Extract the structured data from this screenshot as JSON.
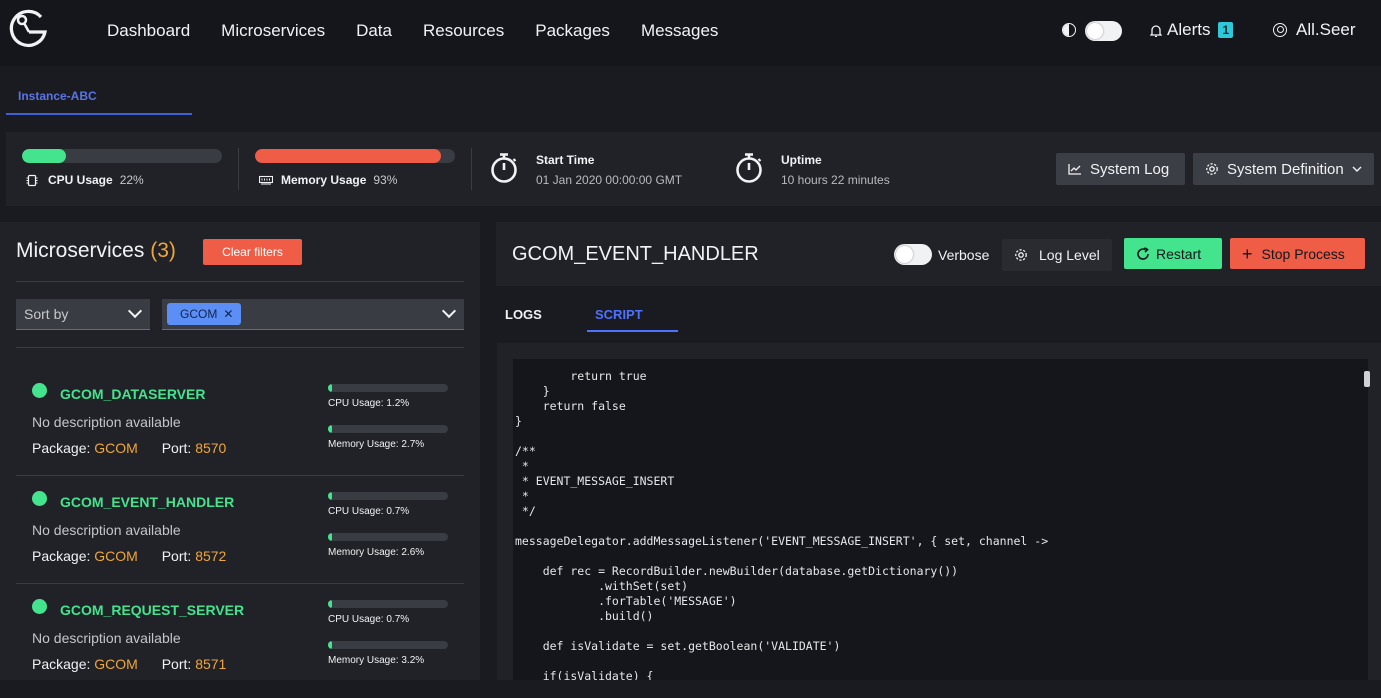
{
  "nav": {
    "items": [
      "Dashboard",
      "Microservices",
      "Data",
      "Resources",
      "Packages",
      "Messages"
    ]
  },
  "header": {
    "alerts_label": "Alerts",
    "alerts_count": "1",
    "user_name": "All.Seer"
  },
  "instance_tab": "Instance-ABC",
  "stats": {
    "cpu_label": "CPU Usage",
    "cpu_value": "22%",
    "cpu_fill": 0.22,
    "memory_label": "Memory Usage",
    "memory_value": "93%",
    "memory_fill": 0.93,
    "start_time_label": "Start Time",
    "start_time_value": "01 Jan 2020 00:00:00 GMT",
    "uptime_label": "Uptime",
    "uptime_value": "10 hours 22 minutes",
    "system_log_label": "System Log",
    "system_definition_label": "System Definition"
  },
  "microservices": {
    "title": "Microservices",
    "count": "(3)",
    "clear_filters_label": "Clear filters",
    "sort_placeholder": "Sort by",
    "filter_chip": "GCOM",
    "items": [
      {
        "name": "GCOM_DATASERVER",
        "description": "No description available",
        "package_label": "Package:",
        "package": "GCOM",
        "port_label": "Port:",
        "port": "8570",
        "cpu_label": "CPU Usage: 1.2%",
        "cpu_fill": 0.012,
        "mem_label": "Memory Usage: 2.7%",
        "mem_fill": 0.027
      },
      {
        "name": "GCOM_EVENT_HANDLER",
        "description": "No description available",
        "package_label": "Package:",
        "package": "GCOM",
        "port_label": "Port:",
        "port": "8572",
        "cpu_label": "CPU Usage: 0.7%",
        "cpu_fill": 0.007,
        "mem_label": "Memory Usage: 2.6%",
        "mem_fill": 0.026
      },
      {
        "name": "GCOM_REQUEST_SERVER",
        "description": "No description available",
        "package_label": "Package:",
        "package": "GCOM",
        "port_label": "Port:",
        "port": "8571",
        "cpu_label": "CPU Usage: 0.7%",
        "cpu_fill": 0.007,
        "mem_label": "Memory Usage: 3.2%",
        "mem_fill": 0.032
      }
    ]
  },
  "process": {
    "title": "GCOM_EVENT_HANDLER",
    "verbose_label": "Verbose",
    "log_level_label": "Log Level",
    "restart_label": "Restart",
    "stop_label": "Stop Process",
    "tabs": [
      "LOGS",
      "SCRIPT"
    ],
    "script": "        return true\n    }\n    return false\n}\n\n/**\n *\n * EVENT_MESSAGE_INSERT\n *\n */\n\nmessageDelegator.addMessageListener('EVENT_MESSAGE_INSERT', { set, channel ->\n\n    def rec = RecordBuilder.newBuilder(database.getDictionary())\n            .withSet(set)\n            .forTable('MESSAGE')\n            .build()\n\n    def isValidate = set.getBoolean('VALIDATE')\n\n    if(isValidate) {"
  },
  "colors": {
    "accent_green": "#44e38e",
    "accent_red": "#ef5d47",
    "accent_blue": "#4c72ff",
    "accent_orange": "#f0a63a"
  }
}
